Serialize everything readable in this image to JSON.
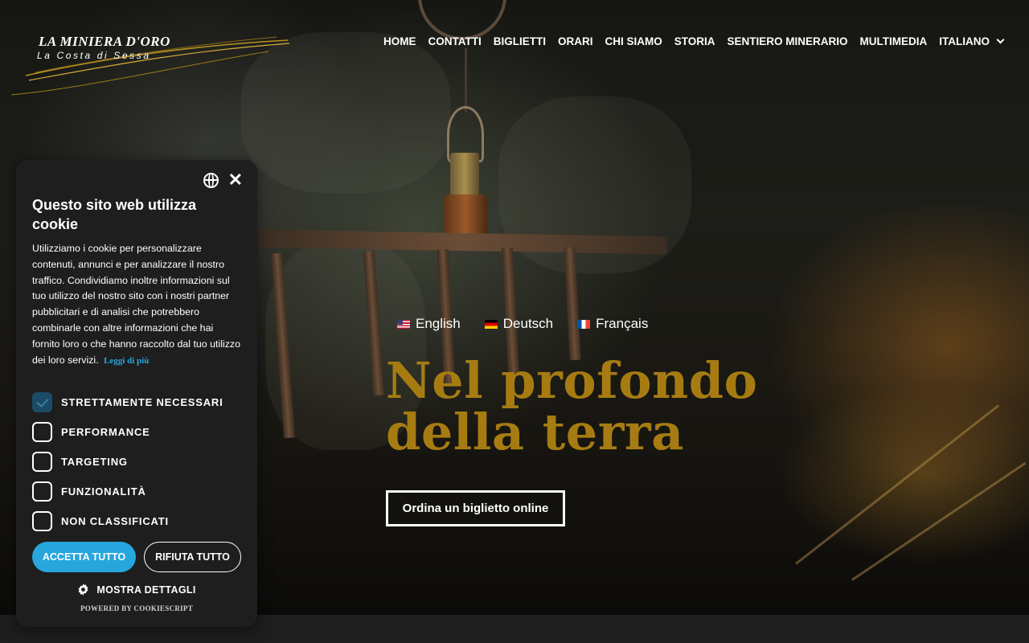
{
  "header": {
    "logo_title": "LA MINIERA D'ORO",
    "logo_subtitle": "La Costa di Sessa",
    "nav": [
      {
        "label": "HOME"
      },
      {
        "label": "CONTATTI"
      },
      {
        "label": "BIGLIETTI"
      },
      {
        "label": "ORARI"
      },
      {
        "label": "CHI SIAMO"
      },
      {
        "label": "STORIA"
      },
      {
        "label": "SENTIERO MINERARIO"
      },
      {
        "label": "MULTIMEDIA"
      }
    ],
    "language_selector": "ITALIANO"
  },
  "hero": {
    "languages": [
      {
        "label": "English",
        "flag": "us-flag-icon"
      },
      {
        "label": "Deutsch",
        "flag": "de-flag-icon"
      },
      {
        "label": "Français",
        "flag": "fr-flag-icon"
      }
    ],
    "title_line1": "Nel profondo",
    "title_line2": "della terra",
    "cta_label": "Ordina un biglietto online"
  },
  "cookie_banner": {
    "title": "Questo sito web utilizza cookie",
    "body": "Utilizziamo i cookie per personalizzare contenuti, annunci e per analizzare il nostro traffico. Condividiamo inoltre informazioni sul tuo utilizzo del nostro sito con i nostri partner pubblicitari e di analisi che potrebbero combinarle con altre informazioni che hai fornito loro o che hanno raccolto dal tuo utilizzo dei loro servizi.",
    "read_more": "Leggi di più",
    "categories": [
      {
        "label": "STRETTAMENTE NECESSARI",
        "checked": true
      },
      {
        "label": "PERFORMANCE",
        "checked": false
      },
      {
        "label": "TARGETING",
        "checked": false
      },
      {
        "label": "FUNZIONALITÀ",
        "checked": false
      },
      {
        "label": "NON CLASSIFICATI",
        "checked": false
      }
    ],
    "accept_label": "ACCETTA TUTTO",
    "reject_label": "RIFIUTA TUTTO",
    "details_label": "MOSTRA DETTAGLI",
    "powered_by": "POWERED BY COOKIESCRIPT"
  },
  "colors": {
    "accent_gold": "#a67c12",
    "cookie_accent": "#27a6de",
    "panel_bg": "#1e1e1f"
  }
}
